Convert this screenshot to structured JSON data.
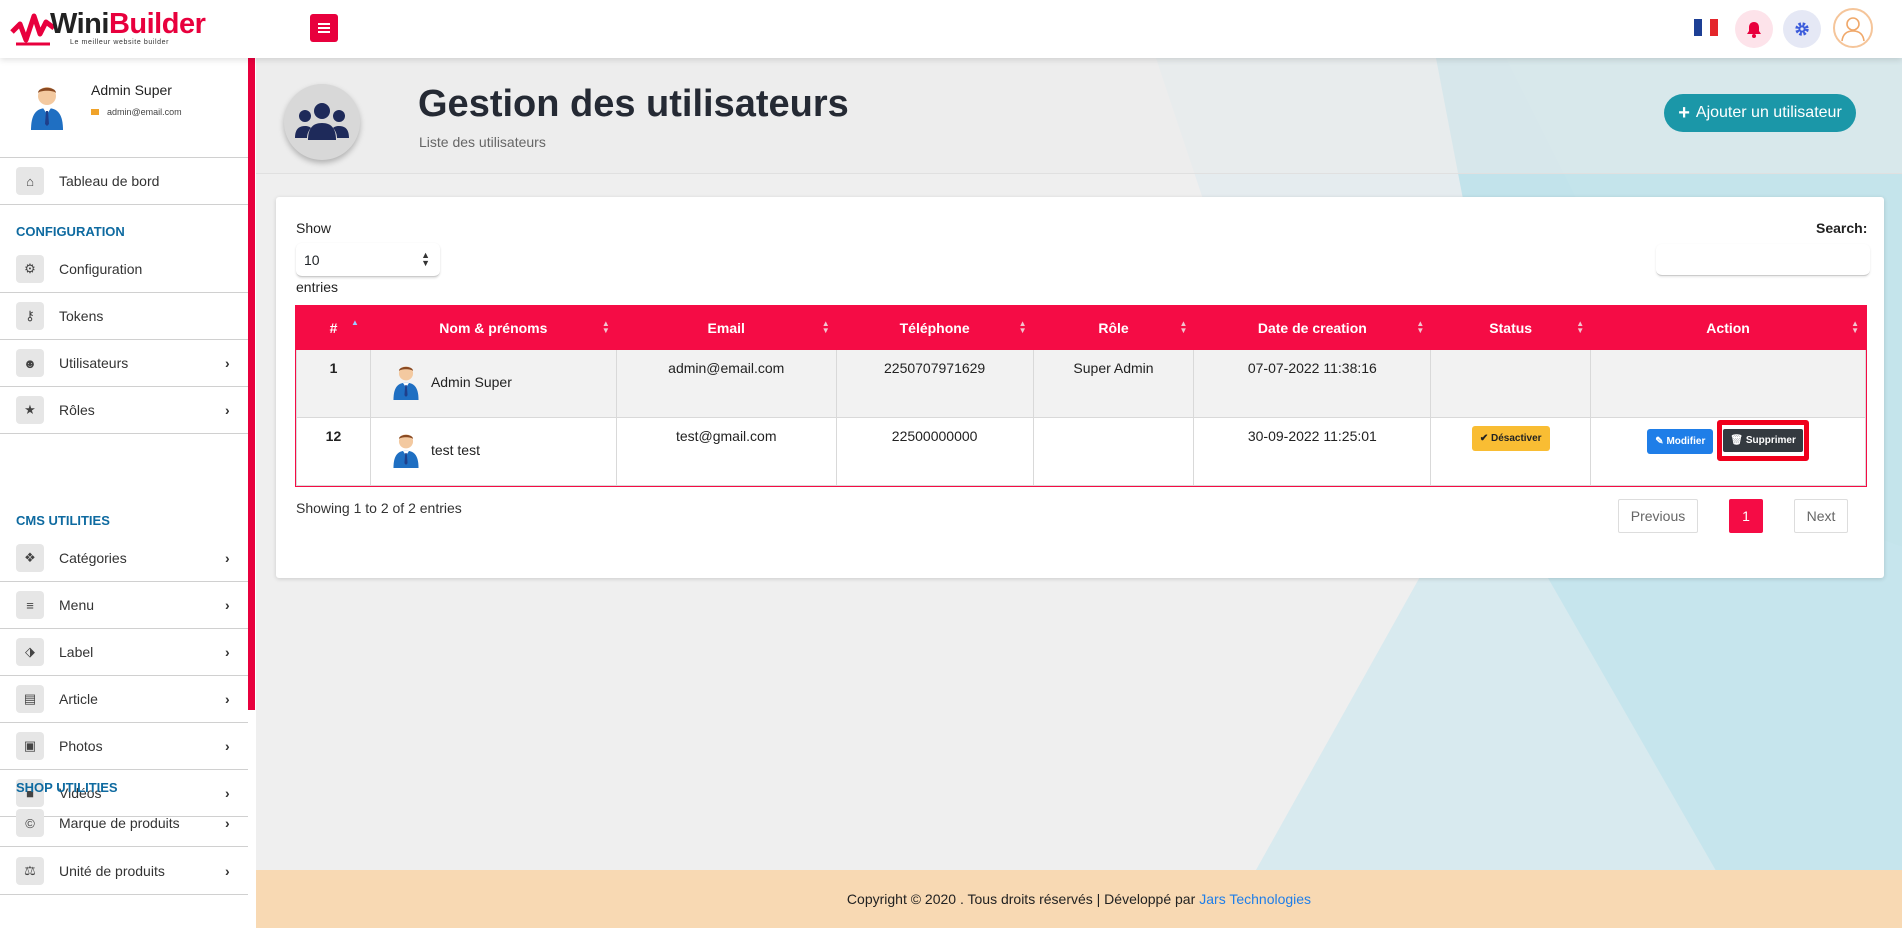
{
  "header": {
    "brand_part1": "Wini",
    "brand_part2": "Builder",
    "slogan": "Le meilleur website builder"
  },
  "profile": {
    "name": "Admin Super",
    "email": "admin@email.com"
  },
  "sidebar": {
    "items": [
      {
        "label": "Tableau de bord",
        "icon": "home-icon"
      },
      {
        "label": "Configuration",
        "icon": "cogs-icon"
      },
      {
        "label": "Tokens",
        "icon": "key-icon"
      },
      {
        "label": "Utilisateurs",
        "icon": "users-icon"
      },
      {
        "label": "Rôles",
        "icon": "star-icon"
      },
      {
        "label": "Catégories",
        "icon": "cubes-icon"
      },
      {
        "label": "Menu",
        "icon": "bars-icon"
      },
      {
        "label": "Label",
        "icon": "tags-icon"
      },
      {
        "label": "Article",
        "icon": "newspaper-icon"
      },
      {
        "label": "Photos",
        "icon": "image-icon"
      },
      {
        "label": "Vidéos",
        "icon": "video-icon"
      },
      {
        "label": "Marque de produits",
        "icon": "copyright-icon"
      },
      {
        "label": "Unité de produits",
        "icon": "balance-icon"
      }
    ],
    "sections": [
      "CONFIGURATION",
      "CMS UTILITIES",
      "SHOP UTILITIES"
    ],
    "chevron": "›"
  },
  "page": {
    "title": "Gestion des utilisateurs",
    "subtitle": "Liste des utilisateurs",
    "add_button": "Ajouter un utilisateur"
  },
  "table_controls": {
    "show_label": "Show",
    "page_size": "10",
    "entries_label": "entries",
    "search_label": "Search:"
  },
  "table": {
    "columns": [
      "#",
      "Nom & prénoms",
      "Email",
      "Téléphone",
      "Rôle",
      "Date de creation",
      "Status",
      "Action"
    ],
    "rows": [
      {
        "id": "1",
        "name": "Admin Super",
        "email": "admin@email.com",
        "phone": "2250707971629",
        "role": "Super Admin",
        "date": "07-07-2022 11:38:16"
      },
      {
        "id": "12",
        "name": "test test",
        "email": "test@gmail.com",
        "phone": "22500000000",
        "role": "",
        "date": "30-09-2022 11:25:01",
        "status_button": "Désactiver",
        "edit_button": "Modifier",
        "delete_button": "Supprimer"
      }
    ]
  },
  "pagination": {
    "info": "Showing 1 to 2 of 2 entries",
    "previous": "Previous",
    "current": "1",
    "next": "Next"
  },
  "footer": {
    "text": "Copyright © 2020 . Tous droits réservés | Développé par",
    "link": "Jars Technologies"
  },
  "colors": {
    "accent": "#e8003d",
    "teal": "#1b97a8",
    "section": "#0e6aa0",
    "footer_bg": "#f8d9b3"
  }
}
